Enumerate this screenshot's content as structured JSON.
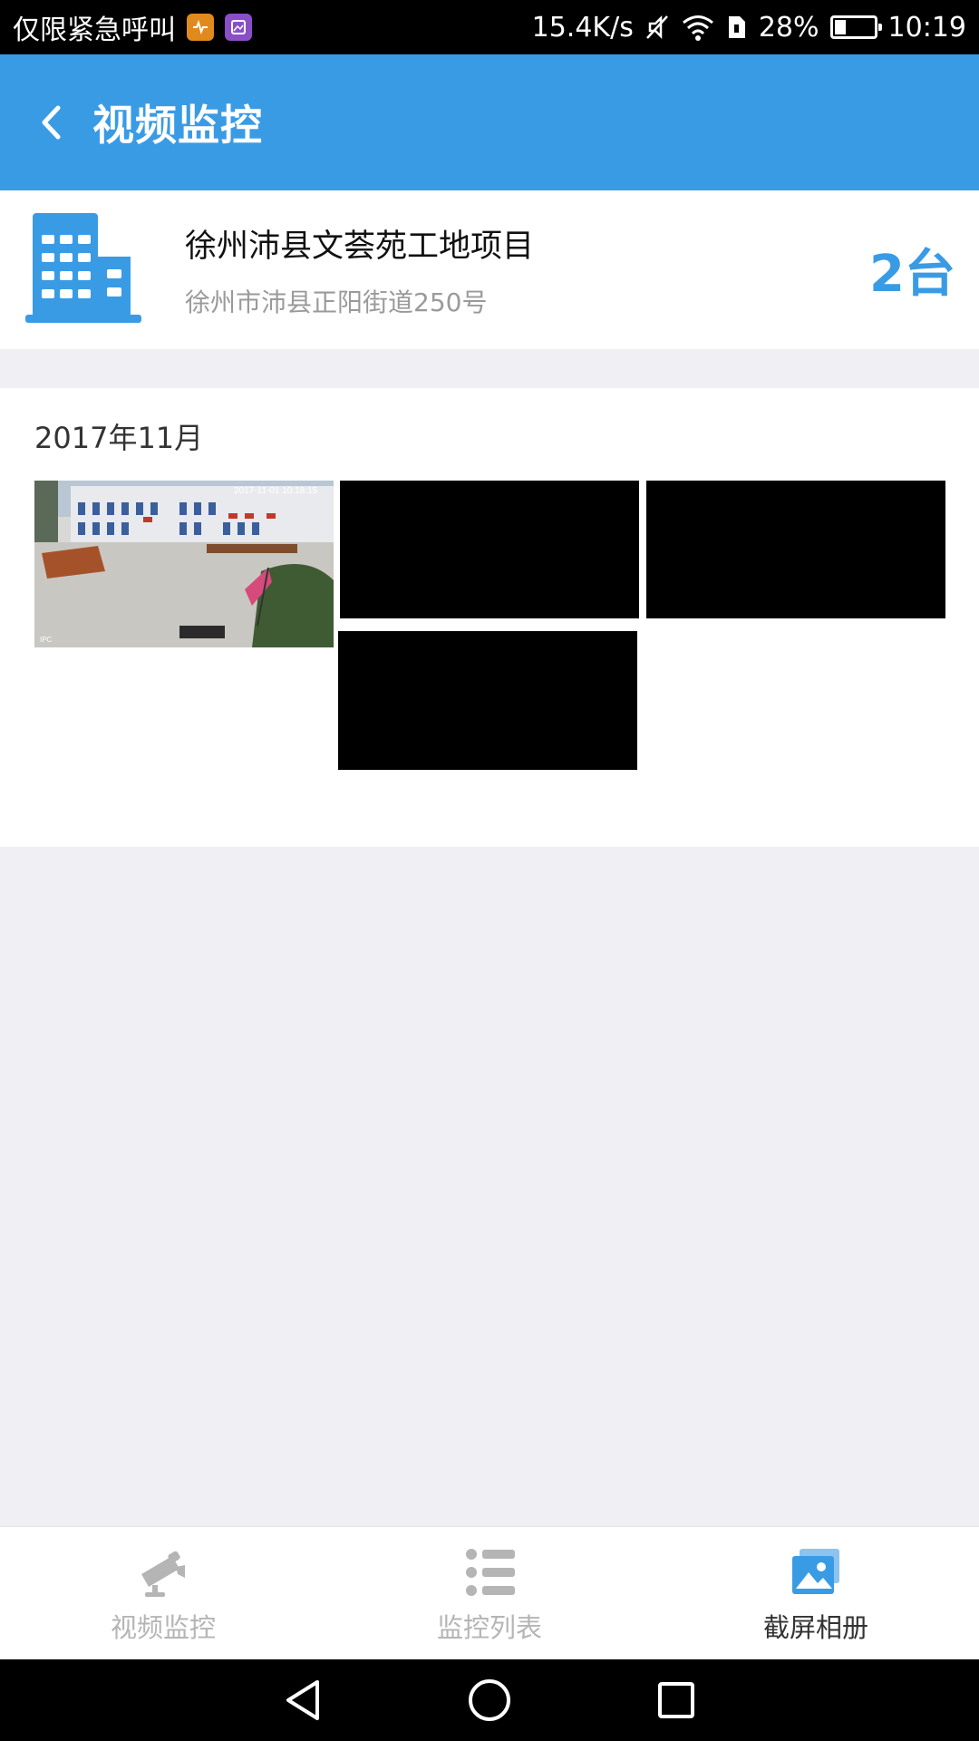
{
  "status_bar": {
    "carrier": "仅限紧急呼叫",
    "network_speed": "15.4K/s",
    "battery": "28%",
    "time": "10:19"
  },
  "header": {
    "title": "视频监控"
  },
  "project": {
    "name": "徐州沛县文荟苑工地项目",
    "address": "徐州市沛县正阳街道250号",
    "device_count": "2台"
  },
  "album": {
    "date": "2017年11月",
    "thumbnail_timestamp": "2017-11-01 10:18:15",
    "thumbnail_camera": "IPC"
  },
  "bottom_nav": {
    "items": [
      {
        "label": "视频监控",
        "icon": "camera-icon",
        "active": false
      },
      {
        "label": "监控列表",
        "icon": "list-icon",
        "active": false
      },
      {
        "label": "截屏相册",
        "icon": "album-icon",
        "active": true
      }
    ]
  },
  "colors": {
    "primary": "#3a9be5",
    "background": "#efeff4",
    "inactive": "#b5b5b5"
  }
}
